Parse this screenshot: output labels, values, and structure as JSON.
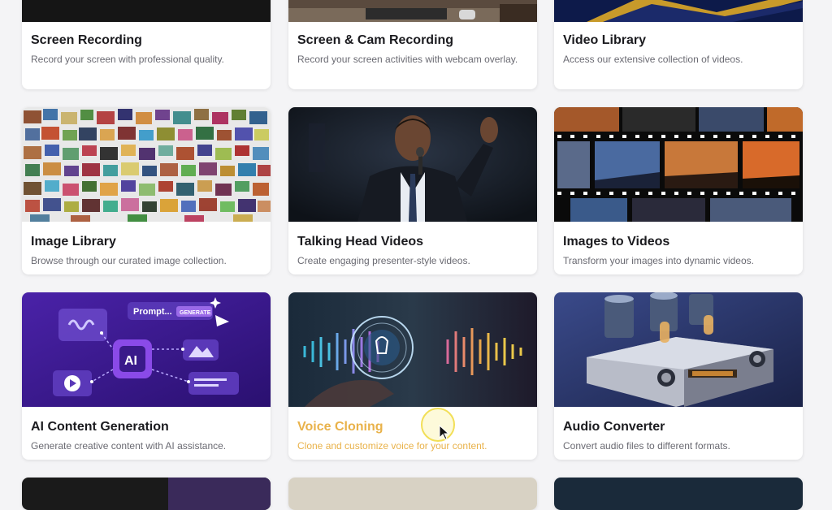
{
  "cards": [
    {
      "title": "Screen Recording",
      "description": "Record your screen with professional quality."
    },
    {
      "title": "Screen & Cam Recording",
      "description": "Record your screen activities with webcam overlay."
    },
    {
      "title": "Video Library",
      "description": "Access our extensive collection of videos."
    },
    {
      "title": "Image Library",
      "description": "Browse through our curated image collection."
    },
    {
      "title": "Talking Head Videos",
      "description": "Create engaging presenter-style videos."
    },
    {
      "title": "Images to Videos",
      "description": "Transform your images into dynamic videos."
    },
    {
      "title": "AI Content Generation",
      "description": "Generate creative content with AI assistance."
    },
    {
      "title": "Voice Cloning",
      "description": "Clone and customize voice for your content."
    },
    {
      "title": "Audio Converter",
      "description": "Convert audio files to different formats."
    }
  ],
  "ai_thumb": {
    "prompt_label": "Prompt...",
    "generate_label": "GENERATE",
    "ai_label": "AI"
  },
  "colors": {
    "accent": "#e9b24a",
    "ai_purple": "#3a1b8c"
  }
}
